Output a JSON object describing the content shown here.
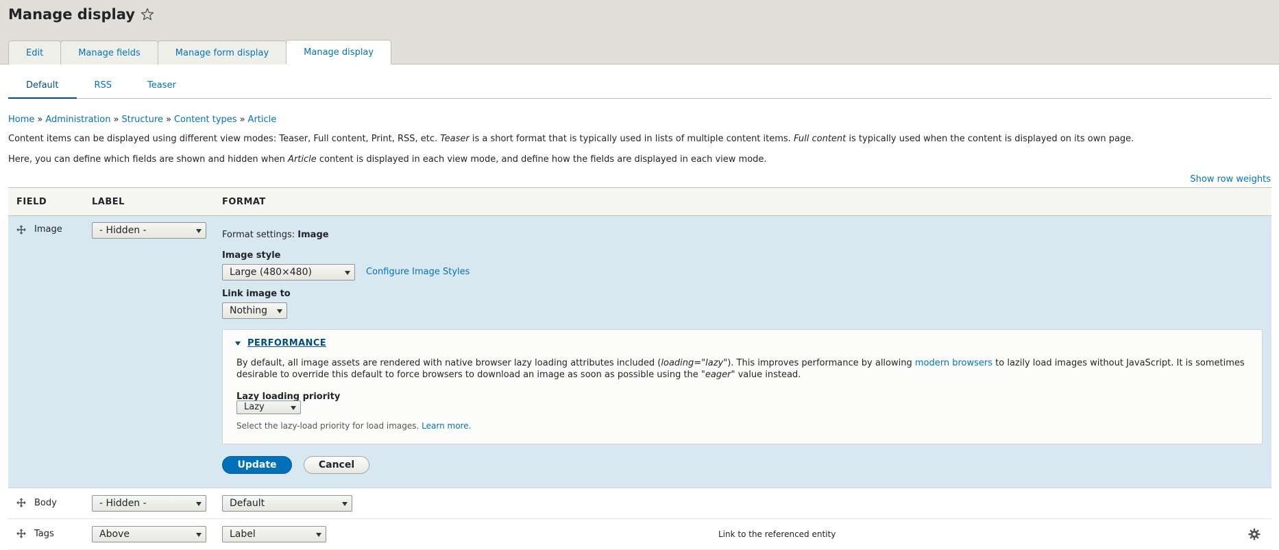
{
  "page": {
    "title": "Manage display"
  },
  "primary_tabs": [
    {
      "label": "Edit"
    },
    {
      "label": "Manage fields"
    },
    {
      "label": "Manage form display"
    },
    {
      "label": "Manage display"
    }
  ],
  "secondary_tabs": [
    {
      "label": "Default"
    },
    {
      "label": "RSS"
    },
    {
      "label": "Teaser"
    }
  ],
  "breadcrumb": [
    "Home",
    "Administration",
    "Structure",
    "Content types",
    "Article"
  ],
  "breadcrumb_separator": "»",
  "intro": {
    "p1_a": "Content items can be displayed using different view modes: Teaser, Full content, Print, RSS, etc. ",
    "p1_em1": "Teaser",
    "p1_b": " is a short format that is typically used in lists of multiple content items. ",
    "p1_em2": "Full content",
    "p1_c": " is typically used when the content is displayed on its own page.",
    "p2_a": "Here, you can define which fields are shown and hidden when ",
    "p2_em": "Article",
    "p2_b": " content is displayed in each view mode, and define how the fields are displayed in each view mode."
  },
  "show_row_weights": "Show row weights",
  "table": {
    "headers": {
      "field": "FIELD",
      "label": "LABEL",
      "format": "FORMAT"
    },
    "image_row": {
      "field": "Image",
      "label_select": "- Hidden -",
      "format_settings_prefix": "Format settings: ",
      "format_settings_name": "Image",
      "image_style_label": "Image style",
      "image_style_value": "Large (480×480)",
      "configure_link": "Configure Image Styles",
      "link_image_label": "Link image to",
      "link_image_value": "Nothing",
      "performance": {
        "title": "PERFORMANCE",
        "desc_a": "By default, all image assets are rendered with native browser lazy loading attributes included (",
        "desc_code": "loading=\"lazy\"",
        "desc_b": "). This improves performance by allowing ",
        "desc_link": "modern browsers",
        "desc_c": " to lazily load images without JavaScript. It is sometimes desirable to override this default to force browsers to download an image as soon as possible using the \"",
        "desc_em": "eager",
        "desc_d": "\" value instead.",
        "priority_label": "Lazy loading priority",
        "priority_value": "Lazy",
        "help_a": "Select the lazy-load priority for load images. ",
        "help_link": "Learn more."
      },
      "update_button": "Update",
      "cancel_button": "Cancel"
    },
    "body_row": {
      "field": "Body",
      "label_select": "- Hidden -",
      "format_select": "Default"
    },
    "tags_row": {
      "field": "Tags",
      "label_select": "Above",
      "format_select": "Label",
      "summary": "Link to the referenced entity"
    }
  },
  "colors": {
    "link": "#0074bd",
    "active_row": "#d8e8f1",
    "primary_button": "#0071b8"
  }
}
